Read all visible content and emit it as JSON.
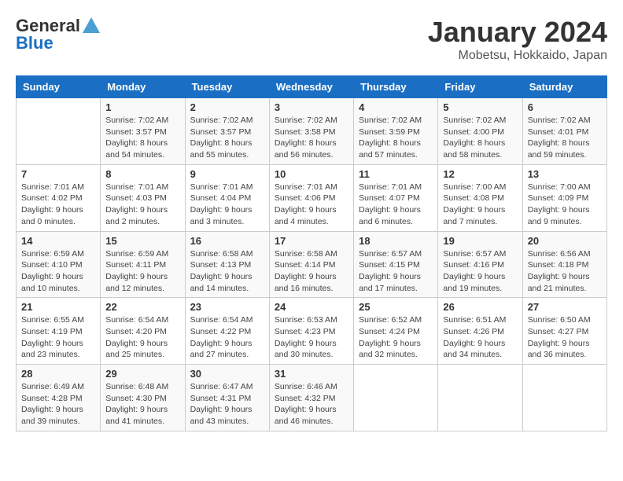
{
  "header": {
    "logo_line1": "General",
    "logo_line2": "Blue",
    "month": "January 2024",
    "location": "Mobetsu, Hokkaido, Japan"
  },
  "days_of_week": [
    "Sunday",
    "Monday",
    "Tuesday",
    "Wednesday",
    "Thursday",
    "Friday",
    "Saturday"
  ],
  "weeks": [
    [
      null,
      {
        "day": "1",
        "sunrise": "7:02 AM",
        "sunset": "3:57 PM",
        "daylight": "8 hours and 54 minutes."
      },
      {
        "day": "2",
        "sunrise": "7:02 AM",
        "sunset": "3:57 PM",
        "daylight": "8 hours and 55 minutes."
      },
      {
        "day": "3",
        "sunrise": "7:02 AM",
        "sunset": "3:58 PM",
        "daylight": "8 hours and 56 minutes."
      },
      {
        "day": "4",
        "sunrise": "7:02 AM",
        "sunset": "3:59 PM",
        "daylight": "8 hours and 57 minutes."
      },
      {
        "day": "5",
        "sunrise": "7:02 AM",
        "sunset": "4:00 PM",
        "daylight": "8 hours and 58 minutes."
      },
      {
        "day": "6",
        "sunrise": "7:02 AM",
        "sunset": "4:01 PM",
        "daylight": "8 hours and 59 minutes."
      }
    ],
    [
      {
        "day": "7",
        "sunrise": "7:01 AM",
        "sunset": "4:02 PM",
        "daylight": "9 hours and 0 minutes."
      },
      {
        "day": "8",
        "sunrise": "7:01 AM",
        "sunset": "4:03 PM",
        "daylight": "9 hours and 2 minutes."
      },
      {
        "day": "9",
        "sunrise": "7:01 AM",
        "sunset": "4:04 PM",
        "daylight": "9 hours and 3 minutes."
      },
      {
        "day": "10",
        "sunrise": "7:01 AM",
        "sunset": "4:06 PM",
        "daylight": "9 hours and 4 minutes."
      },
      {
        "day": "11",
        "sunrise": "7:01 AM",
        "sunset": "4:07 PM",
        "daylight": "9 hours and 6 minutes."
      },
      {
        "day": "12",
        "sunrise": "7:00 AM",
        "sunset": "4:08 PM",
        "daylight": "9 hours and 7 minutes."
      },
      {
        "day": "13",
        "sunrise": "7:00 AM",
        "sunset": "4:09 PM",
        "daylight": "9 hours and 9 minutes."
      }
    ],
    [
      {
        "day": "14",
        "sunrise": "6:59 AM",
        "sunset": "4:10 PM",
        "daylight": "9 hours and 10 minutes."
      },
      {
        "day": "15",
        "sunrise": "6:59 AM",
        "sunset": "4:11 PM",
        "daylight": "9 hours and 12 minutes."
      },
      {
        "day": "16",
        "sunrise": "6:58 AM",
        "sunset": "4:13 PM",
        "daylight": "9 hours and 14 minutes."
      },
      {
        "day": "17",
        "sunrise": "6:58 AM",
        "sunset": "4:14 PM",
        "daylight": "9 hours and 16 minutes."
      },
      {
        "day": "18",
        "sunrise": "6:57 AM",
        "sunset": "4:15 PM",
        "daylight": "9 hours and 17 minutes."
      },
      {
        "day": "19",
        "sunrise": "6:57 AM",
        "sunset": "4:16 PM",
        "daylight": "9 hours and 19 minutes."
      },
      {
        "day": "20",
        "sunrise": "6:56 AM",
        "sunset": "4:18 PM",
        "daylight": "9 hours and 21 minutes."
      }
    ],
    [
      {
        "day": "21",
        "sunrise": "6:55 AM",
        "sunset": "4:19 PM",
        "daylight": "9 hours and 23 minutes."
      },
      {
        "day": "22",
        "sunrise": "6:54 AM",
        "sunset": "4:20 PM",
        "daylight": "9 hours and 25 minutes."
      },
      {
        "day": "23",
        "sunrise": "6:54 AM",
        "sunset": "4:22 PM",
        "daylight": "9 hours and 27 minutes."
      },
      {
        "day": "24",
        "sunrise": "6:53 AM",
        "sunset": "4:23 PM",
        "daylight": "9 hours and 30 minutes."
      },
      {
        "day": "25",
        "sunrise": "6:52 AM",
        "sunset": "4:24 PM",
        "daylight": "9 hours and 32 minutes."
      },
      {
        "day": "26",
        "sunrise": "6:51 AM",
        "sunset": "4:26 PM",
        "daylight": "9 hours and 34 minutes."
      },
      {
        "day": "27",
        "sunrise": "6:50 AM",
        "sunset": "4:27 PM",
        "daylight": "9 hours and 36 minutes."
      }
    ],
    [
      {
        "day": "28",
        "sunrise": "6:49 AM",
        "sunset": "4:28 PM",
        "daylight": "9 hours and 39 minutes."
      },
      {
        "day": "29",
        "sunrise": "6:48 AM",
        "sunset": "4:30 PM",
        "daylight": "9 hours and 41 minutes."
      },
      {
        "day": "30",
        "sunrise": "6:47 AM",
        "sunset": "4:31 PM",
        "daylight": "9 hours and 43 minutes."
      },
      {
        "day": "31",
        "sunrise": "6:46 AM",
        "sunset": "4:32 PM",
        "daylight": "9 hours and 46 minutes."
      },
      null,
      null,
      null
    ]
  ],
  "labels": {
    "sunrise_prefix": "Sunrise: ",
    "sunset_prefix": "Sunset: ",
    "daylight_prefix": "Daylight: "
  }
}
